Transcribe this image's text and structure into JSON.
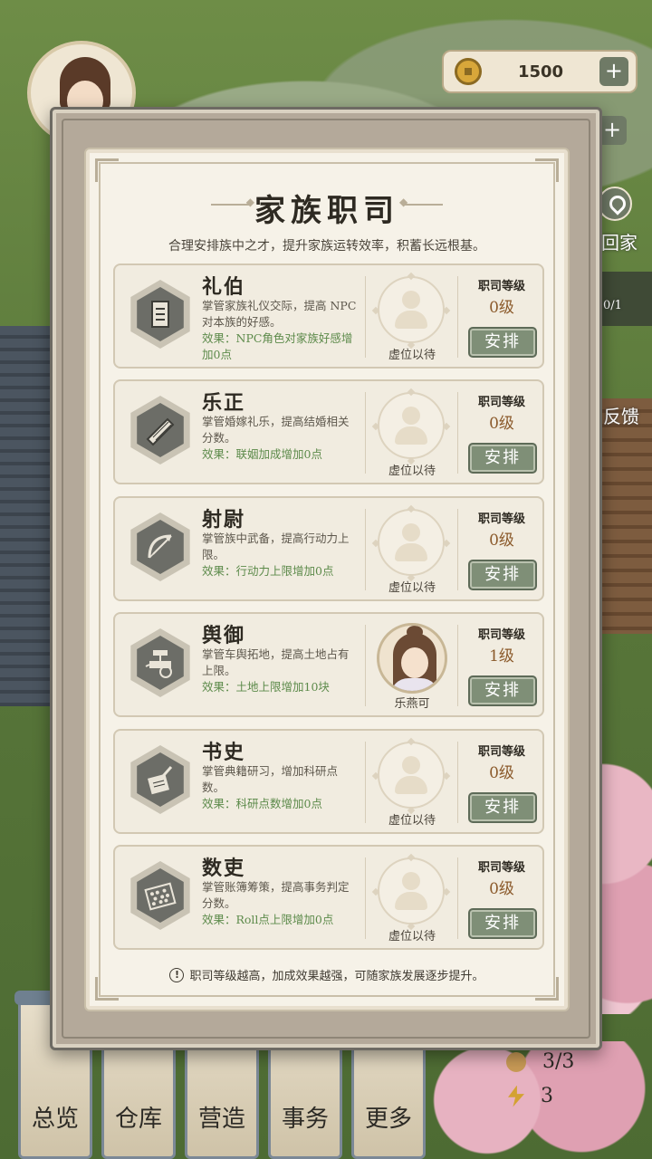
{
  "top_bar": {
    "coins": "1500",
    "plus_label": "+"
  },
  "side": {
    "home_label": "回家",
    "feedback_label": "反馈",
    "quota": "0/1"
  },
  "panel": {
    "title": "家族职司",
    "subtitle": "合理安排族中之才，提升家族运转效率，积蓄长远根基。",
    "level_header": "职司等级",
    "assign_label": "安排",
    "footer_note": "职司等级越高，加成效果越强，可随家族发展逐步提升。",
    "offices": [
      {
        "name": "礼伯",
        "desc": "掌管家族礼仪交际，提高 NPC 对本族的好感。",
        "effect": "效果：NPC角色对家族好感增加0点",
        "level": "0级",
        "holder": "虚位以待",
        "icon": "scroll-icon"
      },
      {
        "name": "乐正",
        "desc": "掌管婚嫁礼乐，提高结婚相关分数。",
        "effect": "效果：联姻加成增加0点",
        "level": "0级",
        "holder": "虚位以待",
        "icon": "zither-icon"
      },
      {
        "name": "射尉",
        "desc": "掌管族中武备，提高行动力上限。",
        "effect": "效果：行动力上限增加0点",
        "level": "0级",
        "holder": "虚位以待",
        "icon": "bow-icon"
      },
      {
        "name": "舆御",
        "desc": "掌管车舆拓地，提高土地占有上限。",
        "effect": "效果：土地上限增加10块",
        "level": "1级",
        "holder": "乐燕可",
        "icon": "chariot-icon"
      },
      {
        "name": "书史",
        "desc": "掌管典籍研习，增加科研点数。",
        "effect": "效果：科研点数增加0点",
        "level": "0级",
        "holder": "虚位以待",
        "icon": "brush-icon"
      },
      {
        "name": "数吏",
        "desc": "掌管账簿筹策，提高事务判定分数。",
        "effect": "效果：Roll点上限增加0点",
        "level": "0级",
        "holder": "虚位以待",
        "icon": "abacus-icon"
      }
    ]
  },
  "bottom_nav": {
    "items": [
      "总览",
      "仓库",
      "营造",
      "事务",
      "更多"
    ]
  },
  "stats": {
    "people": "3/3",
    "energy": "3"
  }
}
